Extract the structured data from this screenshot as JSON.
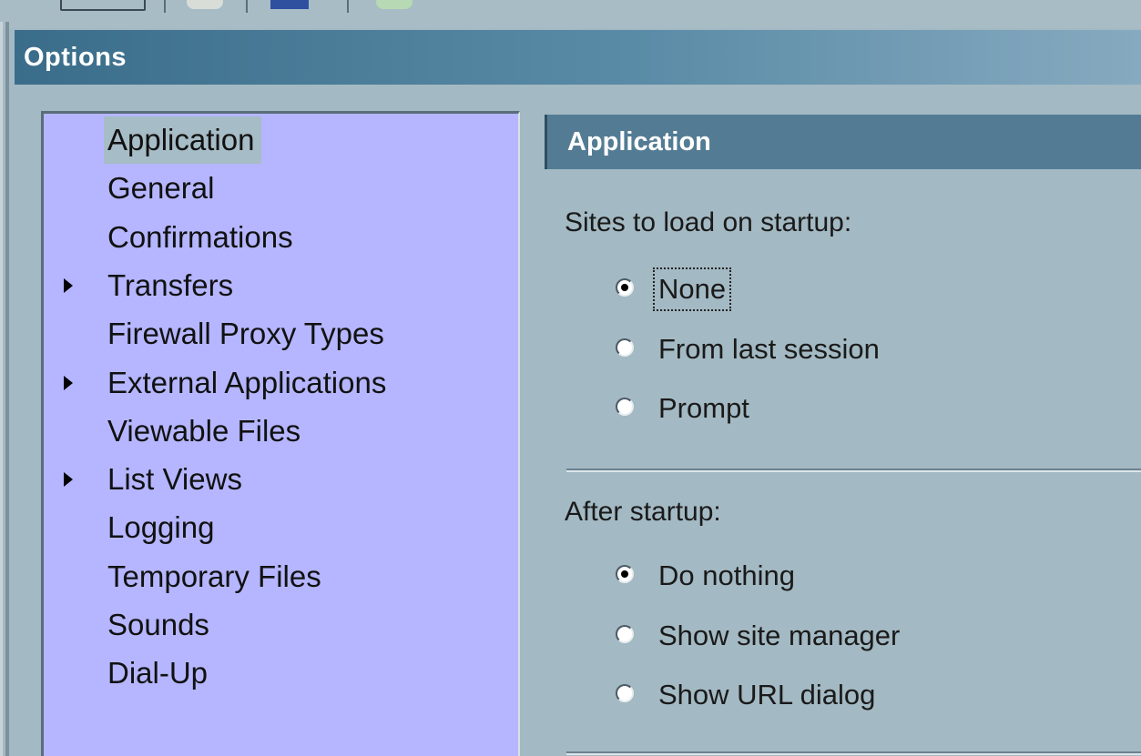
{
  "window": {
    "title": "Options"
  },
  "tree": {
    "selected_index": 0,
    "items": [
      {
        "label": "Application",
        "expandable": false
      },
      {
        "label": "General",
        "expandable": false
      },
      {
        "label": "Confirmations",
        "expandable": false
      },
      {
        "label": "Transfers",
        "expandable": true
      },
      {
        "label": "Firewall Proxy Types",
        "expandable": false
      },
      {
        "label": "External Applications",
        "expandable": true
      },
      {
        "label": "Viewable Files",
        "expandable": false
      },
      {
        "label": "List Views",
        "expandable": true
      },
      {
        "label": "Logging",
        "expandable": false
      },
      {
        "label": "Temporary Files",
        "expandable": false
      },
      {
        "label": "Sounds",
        "expandable": false
      },
      {
        "label": "Dial-Up",
        "expandable": false
      }
    ]
  },
  "panel": {
    "title": "Application",
    "startup": {
      "label": "Sites to load on startup:",
      "options": [
        {
          "label": "None",
          "checked": true
        },
        {
          "label": "From last session",
          "checked": false
        },
        {
          "label": "Prompt",
          "checked": false
        }
      ]
    },
    "after_startup": {
      "label": "After startup:",
      "options": [
        {
          "label": "Do nothing",
          "checked": true
        },
        {
          "label": "Show site manager",
          "checked": false
        },
        {
          "label": "Show URL dialog",
          "checked": false
        }
      ]
    }
  },
  "colors": {
    "tree_background": "#b5b6ff",
    "title_bar": "#3a6d8a",
    "panel_header": "#537c94",
    "dialog_background": "#a3b9c3"
  }
}
